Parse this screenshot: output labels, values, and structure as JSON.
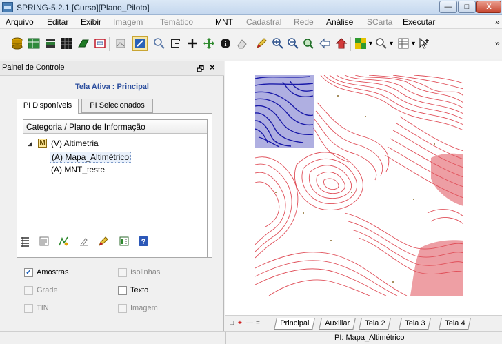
{
  "window": {
    "title": "SPRING-5.2.1 [Curso][Plano_Piloto]",
    "minimize_glyph": "—",
    "maximize_glyph": "□",
    "close_glyph": "X"
  },
  "menu": [
    {
      "label": "Arquivo",
      "enabled": true
    },
    {
      "label": "Editar",
      "enabled": true
    },
    {
      "label": "Exibir",
      "enabled": true
    },
    {
      "label": "Imagem",
      "enabled": false
    },
    {
      "label": "Temático",
      "enabled": false
    },
    {
      "label": "MNT",
      "enabled": true
    },
    {
      "label": "Cadastral",
      "enabled": false
    },
    {
      "label": "Rede",
      "enabled": false
    },
    {
      "label": "Análise",
      "enabled": true
    },
    {
      "label": "SCarta",
      "enabled": false
    },
    {
      "label": "Executar",
      "enabled": true
    },
    {
      "label": "»",
      "enabled": true
    }
  ],
  "toolbar": {
    "icons": [
      "database-icon",
      "table-icon",
      "layers-icon",
      "grid-icon",
      "polygon-icon",
      "window-icon",
      "picture-icon",
      "active-draw-icon",
      "zoom-search-icon",
      "edit-vector-icon",
      "crosshair-icon",
      "pan-icon",
      "info-icon",
      "erase-icon",
      "pencil-icon",
      "zoom-in-icon",
      "zoom-out-icon",
      "zoom-area-icon",
      "back-arrow-icon",
      "home-icon",
      "palette-icon",
      "magnifier-dropdown-icon",
      "table-view-icon",
      "pointer-plus-icon"
    ],
    "overflow": "»"
  },
  "control_panel": {
    "title": "Painel de Controle",
    "pin": "🗗",
    "close": "×",
    "active_screen": "Tela Ativa : Principal",
    "tabs": [
      "PI Disponíveis",
      "PI Selecionados"
    ],
    "tree_header": "Categoria / Plano de Informação",
    "tree": {
      "category_badge": "M",
      "category": "(V) Altimetria",
      "items": [
        "(A) Mapa_Altimétrico",
        "(A) MNT_teste"
      ]
    },
    "options": {
      "amostras": "Amostras",
      "isolinhas": "Isolinhas",
      "grade": "Grade",
      "texto": "Texto",
      "tin": "TIN",
      "imagem": "Imagem"
    }
  },
  "colors": {
    "contour_red": "#e0505a",
    "contour_blue": "#1a1aa8",
    "accent_title": "#2d4f9e"
  },
  "bottom": {
    "nav": [
      "□",
      "+",
      "—",
      "="
    ],
    "tabs": [
      "Principal",
      "Auxiliar",
      "Tela 2",
      "Tela 3",
      "Tela 4"
    ],
    "status": "PI: Mapa_Altimétrico"
  }
}
